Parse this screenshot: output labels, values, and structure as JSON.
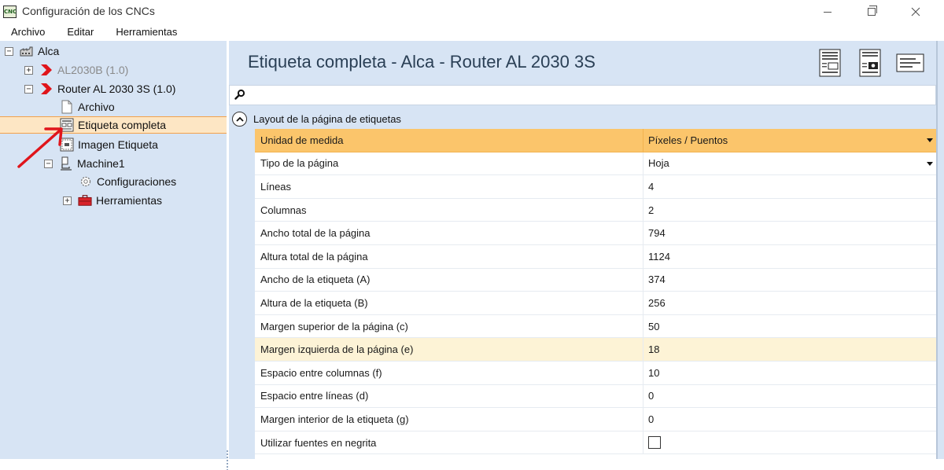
{
  "window": {
    "title": "Configuración de los CNCs",
    "app_icon_text": "CNC"
  },
  "menu": [
    "Archivo",
    "Editar",
    "Herramientas"
  ],
  "tree": {
    "root": "Alca",
    "nodes": [
      {
        "label": "AL2030B (1.0)",
        "state": "collapsed",
        "muted": true
      },
      {
        "label": "Router AL 2030 3S (1.0)",
        "state": "expanded"
      },
      {
        "label": "Archivo"
      },
      {
        "label": "Etiqueta completa",
        "selected": true
      },
      {
        "label": "Imagen Etiqueta"
      },
      {
        "label": "Machine1",
        "state": "expanded"
      },
      {
        "label": "Configuraciones"
      },
      {
        "label": "Herramientas",
        "state": "collapsed"
      }
    ]
  },
  "main": {
    "title": "Etiqueta completa - Alca - Router AL 2030 3S",
    "search_value": "",
    "category": "Layout de la página de etiquetas",
    "properties": [
      {
        "name": "Unidad de medida",
        "value": "Píxeles / Puentos",
        "dropdown": true,
        "selected": true
      },
      {
        "name": "Tipo de la página",
        "value": "Hoja",
        "dropdown": true
      },
      {
        "name": "Líneas",
        "value": "4"
      },
      {
        "name": "Columnas",
        "value": "2"
      },
      {
        "name": "Ancho total de la página",
        "value": "794"
      },
      {
        "name": "Altura total de la página",
        "value": "1124"
      },
      {
        "name": "Ancho de la etiqueta (A)",
        "value": "374"
      },
      {
        "name": "Altura de la etiqueta (B)",
        "value": "256"
      },
      {
        "name": "Margen superior de la página (c)",
        "value": "50"
      },
      {
        "name": "Margen izquierda de la página (e)",
        "value": "18",
        "highlighted": true
      },
      {
        "name": "Espacio entre columnas (f)",
        "value": "10"
      },
      {
        "name": "Espacio entre líneas (d)",
        "value": "0"
      },
      {
        "name": "Margen interior de la etiqueta (g)",
        "value": "0"
      },
      {
        "name": "Utilizar fuentes en negrita",
        "value": "",
        "checkbox": true,
        "checked": false
      }
    ]
  },
  "colors": {
    "panel_bg": "#d7e4f4",
    "selected_row": "#fbc56b",
    "tree_selected": "#fde6c4",
    "annotation_arrow": "#e0151b"
  }
}
